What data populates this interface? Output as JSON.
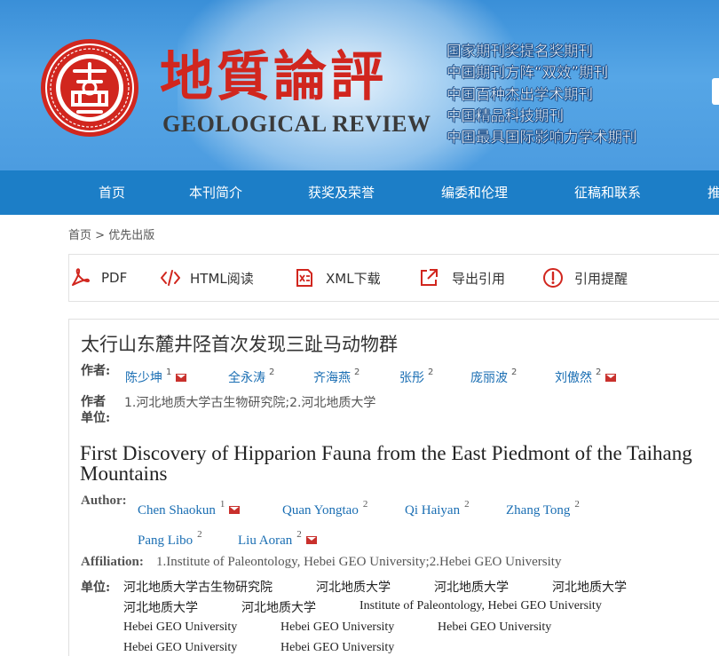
{
  "header": {
    "title_cn": "地質論評",
    "title_en": "GEOLOGICAL REVIEW",
    "honors": [
      "国家期刊奖提名奖期刊",
      "中国期刊方阵“双效”期刊",
      "中国百种杰出学术期刊",
      "中国精品科技期刊",
      "中国最具国际影响力学术期刊"
    ],
    "colors": {
      "seal": "#d1261e",
      "banner": "#4c9ce0",
      "nav": "#1c7ec7"
    }
  },
  "nav": {
    "items": [
      "首页",
      "本刊简介",
      "获奖及荣誉",
      "编委和伦理",
      "征稿和联系",
      "推"
    ]
  },
  "breadcrumb": {
    "home": "首页",
    "sep": " > ",
    "current": "优先出版"
  },
  "toolbar": {
    "pdf": "PDF",
    "html": "HTML阅读",
    "xml": "XML下载",
    "export": "导出引用",
    "alert": "引用提醒"
  },
  "article": {
    "title_cn": "太行山东麓井陉首次发现三趾马动物群",
    "authors_label_cn": "作者:",
    "authors_cn": [
      {
        "name": "陈少坤",
        "aff": "1",
        "email": true
      },
      {
        "name": "全永涛",
        "aff": "2",
        "email": false
      },
      {
        "name": "齐海燕",
        "aff": "2",
        "email": false
      },
      {
        "name": "张彤",
        "aff": "2",
        "email": false
      },
      {
        "name": "庞丽波",
        "aff": "2",
        "email": false
      },
      {
        "name": "刘傲然",
        "aff": "2",
        "email": true
      }
    ],
    "aff_label_cn_1": "作者",
    "aff_label_cn_2": "单位:",
    "affiliation_cn": "1.河北地质大学古生物研究院;2.河北地质大学",
    "title_en": "First Discovery of Hipparion Fauna from the East Piedmont of the Taihang Mountains",
    "authors_label_en": "Author:",
    "authors_en": [
      {
        "name": "Chen Shaokun",
        "aff": "1",
        "email": true
      },
      {
        "name": "Quan Yongtao",
        "aff": "2",
        "email": false
      },
      {
        "name": "Qi Haiyan",
        "aff": "2",
        "email": false
      },
      {
        "name": "Zhang Tong",
        "aff": "2",
        "email": false
      },
      {
        "name": "Pang Libo",
        "aff": "2",
        "email": false
      },
      {
        "name": "Liu Aoran",
        "aff": "2",
        "email": true
      }
    ],
    "aff_label_en": "Affiliation:",
    "affiliation_en": "1.Institute of Paleontology, Hebei GEO University;2.Hebei GEO University",
    "unit_label": "单位:",
    "units": [
      "河北地质大学古生物研究院",
      "河北地质大学",
      "河北地质大学",
      "河北地质大学",
      "河北地质大学",
      "河北地质大学",
      "Institute of Paleontology, Hebei GEO University",
      "Hebei GEO University",
      "Hebei GEO University",
      "Hebei GEO University",
      "Hebei GEO University",
      "Hebei GEO University"
    ]
  }
}
